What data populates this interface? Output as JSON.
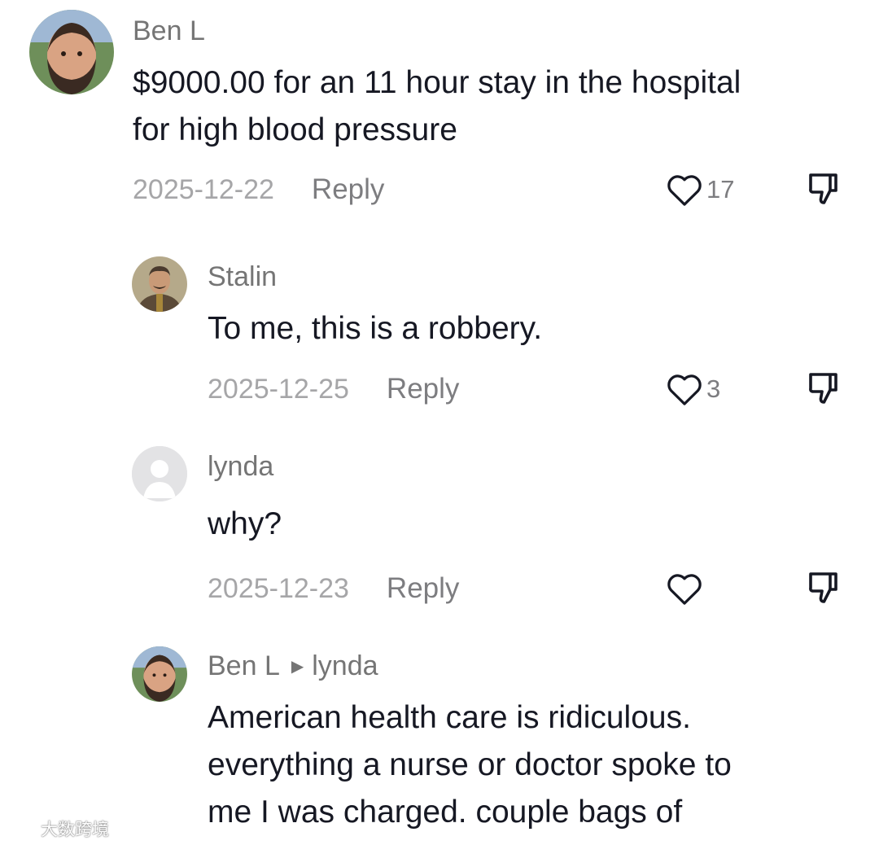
{
  "comments": [
    {
      "username": "Ben L",
      "text_lines": [
        "$9000.00 for an 11 hour stay in the hospital",
        "for high blood pressure"
      ],
      "date": "2025-12-22",
      "reply_label": "Reply",
      "like_count": "17",
      "avatar": "bearded-man-photo"
    },
    {
      "username": "Stalin",
      "text_lines": [
        "To me, this is a robbery."
      ],
      "date": "2025-12-25",
      "reply_label": "Reply",
      "like_count": "3",
      "avatar": "portrait-painting"
    },
    {
      "username": "lynda",
      "text_lines": [
        "why?"
      ],
      "date": "2025-12-23",
      "reply_label": "Reply",
      "like_count": "",
      "avatar": "default-avatar"
    },
    {
      "username": "Ben L",
      "reply_to": "lynda",
      "text_lines": [
        "American health care is ridiculous.",
        "everything a nurse or doctor spoke to",
        "me I was charged. couple bags of"
      ],
      "avatar": "bearded-man-photo"
    }
  ],
  "icons": {
    "like": "heart-outline-icon",
    "dislike": "thumbs-down-icon",
    "reply_arrow": "triangle-right-icon"
  },
  "watermark": {
    "text": "大数跨境"
  },
  "colors": {
    "username": "#757575",
    "body": "#161823",
    "date": "#a6a6a8",
    "reply": "#7d7d80",
    "icon": "#161823"
  }
}
